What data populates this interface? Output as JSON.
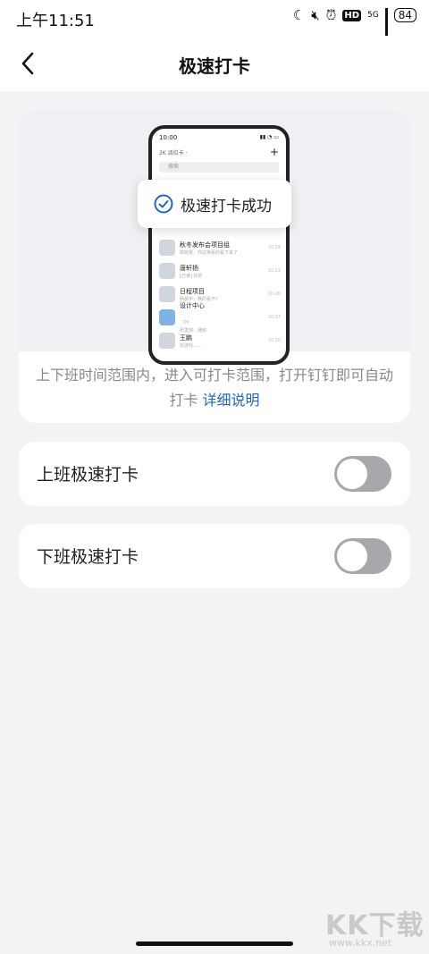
{
  "status_bar": {
    "time": "上午11:51",
    "network": "5G",
    "hd": "HD",
    "battery": "84"
  },
  "header": {
    "title": "极速打卡"
  },
  "preview": {
    "phone_time": "10:00",
    "header_text": "2K 派拉卡 ·",
    "search_placeholder": "搜索",
    "toast_text": "极速打卡成功",
    "chat_items": [
      {
        "name": "秋冬发布会项目组",
        "sub": "陈晓雯：你在常看的看下来了",
        "time": "10:24",
        "avatar": "group"
      },
      {
        "name": "唐轩扬",
        "sub": "[已读] 好的",
        "time": "10:22",
        "avatar": "person"
      },
      {
        "name": "日程项目",
        "sub": "杨晨宇：晚的看不?",
        "time": "10:20",
        "avatar": "group"
      },
      {
        "name": "设计中心",
        "sub": "研发部：通知",
        "time": "10:17",
        "avatar": "blue",
        "badge": "TM"
      },
      {
        "name": "王鹏",
        "sub": "玩游戏……",
        "time": "10:10",
        "avatar": "person"
      }
    ]
  },
  "description": {
    "text": "上下班时间范围内，进入可打卡范围，打开钉钉即可自动打卡",
    "link": "详细说明"
  },
  "settings": [
    {
      "label": "上班极速打卡",
      "on": false
    },
    {
      "label": "下班极速打卡",
      "on": false
    }
  ],
  "watermark": {
    "big": "KK下载",
    "small": "www.kkx.net"
  }
}
